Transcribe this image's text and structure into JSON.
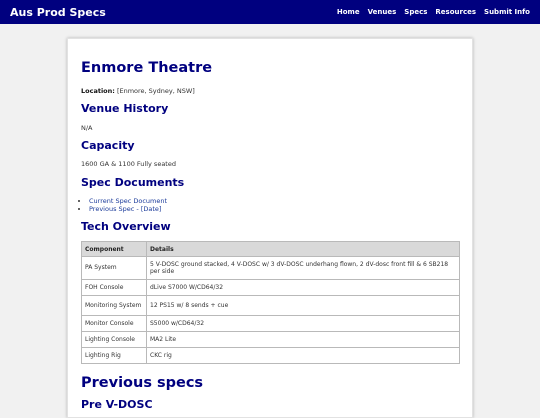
{
  "site": {
    "brand": "Aus Prod Specs"
  },
  "nav": {
    "items": [
      "Home",
      "Venues",
      "Specs",
      "Resources",
      "Submit Info"
    ]
  },
  "venue": {
    "title": "Enmore Theatre",
    "location_label": "Location:",
    "location_value": " [Enmore, Sydney, NSW]"
  },
  "sections": {
    "history_heading": "Venue History",
    "history_text": "N/A",
    "capacity_heading": "Capacity",
    "capacity_text": "1600 GA & 1100 Fully seated",
    "docs_heading": "Spec Documents",
    "docs": [
      "Current Spec Document",
      "Previous Spec - [Date]"
    ],
    "tech_heading": "Tech Overview",
    "previous_heading": "Previous specs",
    "previous_sub": "Pre V-DOSC"
  },
  "table": {
    "headers": [
      "Component",
      "Details"
    ],
    "rows": [
      [
        "PA System",
        "5 V-DOSC ground stacked, 4 V-DOSC w/ 3 dV-DOSC underhang flown, 2 dV-dosc front fill & 6 SB218 per side"
      ],
      [
        "FOH Console",
        "dLive S7000 W/CD64/32"
      ],
      [
        "Monitoring System",
        "12 PS15 w/ 8 sends + cue"
      ],
      [
        "Monitor Console",
        "S5000 w/CD64/32"
      ],
      [
        "Lighting Console",
        "MA2 Lite"
      ],
      [
        "Lighting Rig",
        "CKC rig"
      ]
    ]
  }
}
